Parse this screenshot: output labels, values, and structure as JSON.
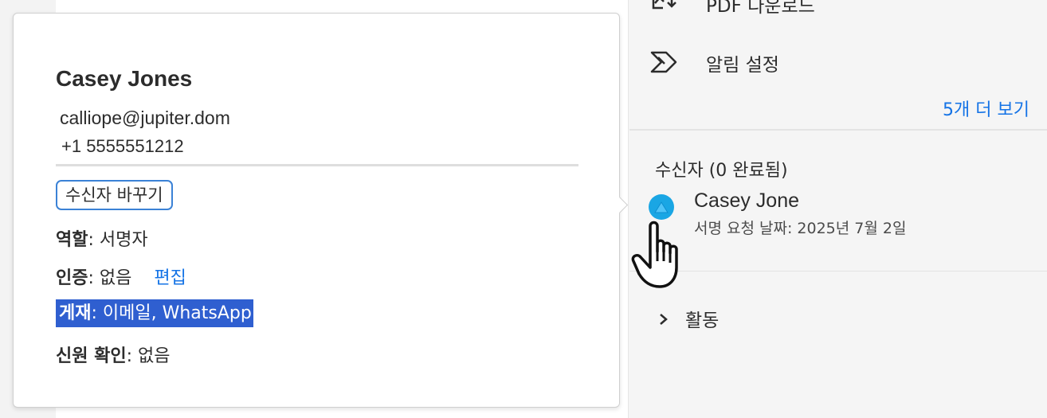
{
  "popover": {
    "name": "Casey Jones",
    "email": "calliope@jupiter.dom",
    "phone": "+1 5555551212",
    "change_button": "수신자 바꾸기",
    "role_label": "역할",
    "role_value": ": 서명자",
    "auth_label": "인증",
    "auth_value": ": 없음",
    "auth_edit": "편집",
    "delivery_label": "게재",
    "delivery_value": ": 이메일, WhatsApp",
    "identity_label": "신원 확인",
    "identity_value": ": 없음"
  },
  "panel": {
    "menu": [
      {
        "label": "PDF 다운로드",
        "icon": "pdf-download-icon"
      },
      {
        "label": "알림 설정",
        "icon": "notification-settings-icon"
      }
    ],
    "more_link": "5개 더 보기",
    "recipients_heading": "수신자 (0 완료됨)",
    "recipient": {
      "name": "Casey Jone",
      "date": "서명 요청 날짜: 2025년 7월 2일"
    },
    "activity_label": "활동"
  },
  "colors": {
    "accent": "#1473e6",
    "highlight": "#2f5fd0",
    "avatar": "#1aa6e4"
  }
}
